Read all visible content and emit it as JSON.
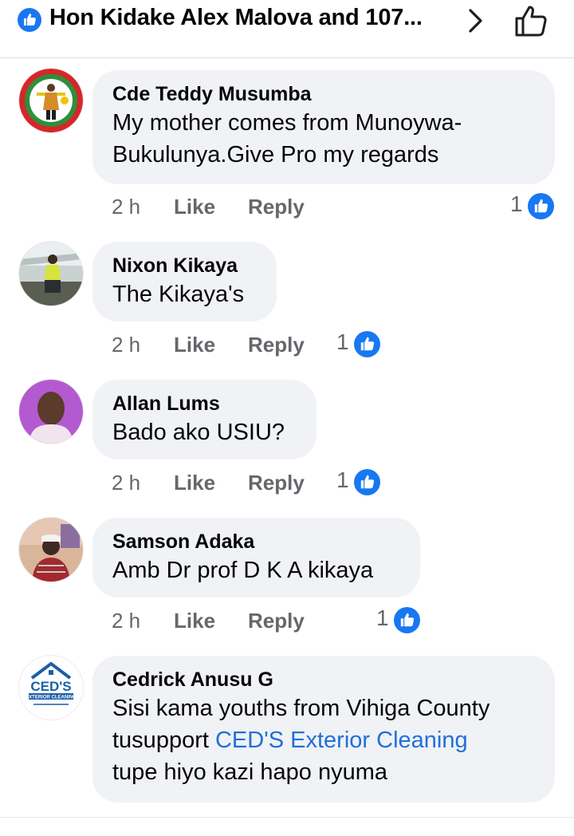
{
  "header": {
    "title": "Hon Kidake Alex Malova and 107...",
    "like_icon": "like-reaction-icon",
    "chevron_icon": "chevron-right-icon",
    "thumb_icon": "thumbs-up-outline-icon"
  },
  "colors": {
    "facebook_blue": "#1877f2",
    "link_blue": "#216fdb",
    "bubble_bg": "#f0f2f5",
    "meta_gray": "#65676b"
  },
  "action_labels": {
    "like": "Like",
    "reply": "Reply"
  },
  "comments": [
    {
      "author": "Cde Teddy Musumba",
      "text": "My mother comes from Munoywa-\nBukulunya.Give Pro my regards",
      "time": "2 h",
      "reactions": "1"
    },
    {
      "author": "Nixon Kikaya",
      "text": "The Kikaya's",
      "time": "2 h",
      "reactions": "1"
    },
    {
      "author": "Allan Lums",
      "text": "Bado ako USIU?",
      "time": "2 h",
      "reactions": "1"
    },
    {
      "author": "Samson Adaka",
      "text": "Amb Dr prof D K A kikaya",
      "time": "2 h",
      "reactions": "1"
    },
    {
      "author": "Cedrick Anusu G",
      "text_before": "Sisi kama youths from Vihiga County\ntusupport ",
      "text_link": "CED'S Exterior Cleaning",
      "text_after": "\ntupe hiyo kazi hapo nyuma"
    }
  ],
  "avatar_texts": {
    "ceds_logo_main": "CED'S",
    "ceds_logo_sub": "EXTERIOR CLEANING"
  }
}
